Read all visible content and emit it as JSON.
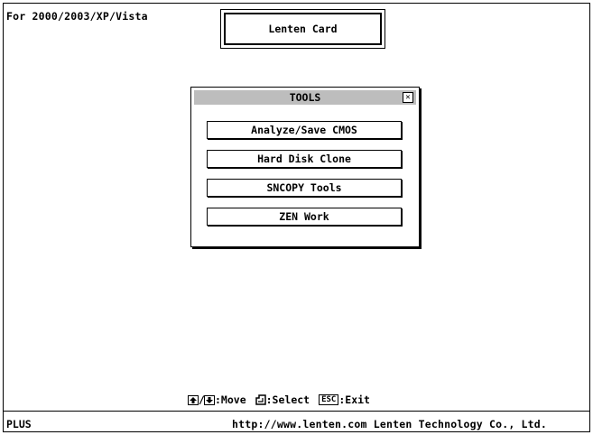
{
  "header": {
    "os_line": "For 2000/2003/XP/Vista",
    "product_title": "Lenten Card"
  },
  "dialog": {
    "title": "TOOLS",
    "close_glyph": "✕",
    "buttons": [
      {
        "label": "Analyze/Save CMOS"
      },
      {
        "label": "Hard Disk Clone"
      },
      {
        "label": "SNCOPY Tools"
      },
      {
        "label": "ZEN Work"
      }
    ]
  },
  "hints": {
    "move_label": ":Move",
    "select_label": ":Select",
    "esc_key": "ESC",
    "exit_label": ":Exit"
  },
  "status": {
    "edition": "PLUS",
    "company": "http://www.lenten.com  Lenten Technology Co., Ltd."
  },
  "icons": [
    "arrow-up-icon",
    "arrow-down-icon",
    "enter-key-icon",
    "close-icon"
  ]
}
